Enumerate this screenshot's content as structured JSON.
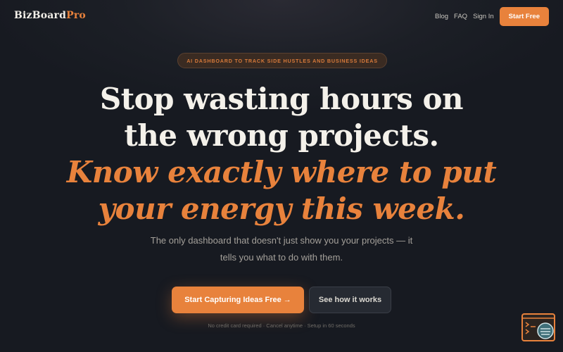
{
  "nav": {
    "logo_main": "BizBoard",
    "logo_accent": "Pro",
    "links": [
      "Blog",
      "FAQ",
      "Sign In"
    ],
    "cta": "Start Free"
  },
  "hero": {
    "pill": "AI DASHBOARD TO TRACK SIDE HUSTLES AND BUSINESS IDEAS",
    "headline_line1": "Stop wasting hours on",
    "headline_line2": "the wrong projects.",
    "accent_line1": "Know exactly where to put",
    "accent_line2": "your energy this week.",
    "subtitle_line1": "The only dashboard that doesn't just show you your projects — it",
    "subtitle_line2": "tells you what to do with them.",
    "primary_cta": "Start Capturing Ideas Free →",
    "secondary_cta": "See how it works",
    "fine_print": "No credit card required · Cancel anytime · Setup in 60 seconds"
  },
  "colors": {
    "accent": "#e8823c",
    "background": "#1c1f26",
    "headline": "#f4f1ea",
    "muted": "#a4a09a"
  },
  "icons": {
    "floating_widget": "terminal-chat-widget-icon"
  }
}
